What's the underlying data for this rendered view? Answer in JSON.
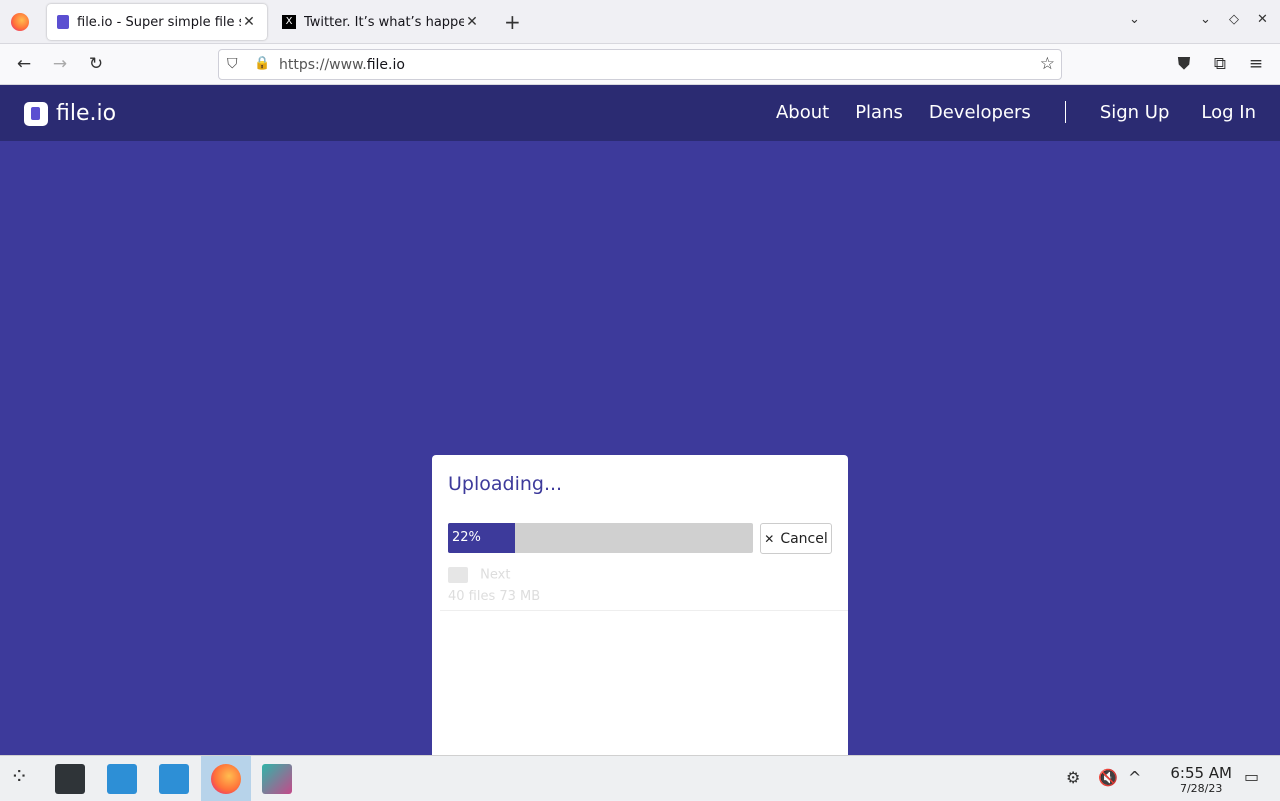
{
  "browser": {
    "tabs": [
      {
        "label": "file.io - Super simple file sh",
        "active": true
      },
      {
        "label": "Twitter. It’s what’s happeni",
        "active": false
      }
    ],
    "url_prefix": "https://www.",
    "url_domain": "file.io"
  },
  "site": {
    "logo_text": "file.io",
    "nav": {
      "about": "About",
      "plans": "Plans",
      "developers": "Developers",
      "sign_up": "Sign Up",
      "log_in": "Log In"
    }
  },
  "upload_card": {
    "title": "Uploading...",
    "progress_percent": 22,
    "progress_label": "22%",
    "cancel_label": "Cancel",
    "next_label": "Next",
    "next_sub": "40 files 73 MB"
  },
  "taskbar": {
    "time": "6:55 AM",
    "date": "7/28/23"
  },
  "colors": {
    "header_bg": "#2b2b72",
    "page_bg": "#3d3a9b",
    "progress_fill": "#3d3a9b"
  }
}
